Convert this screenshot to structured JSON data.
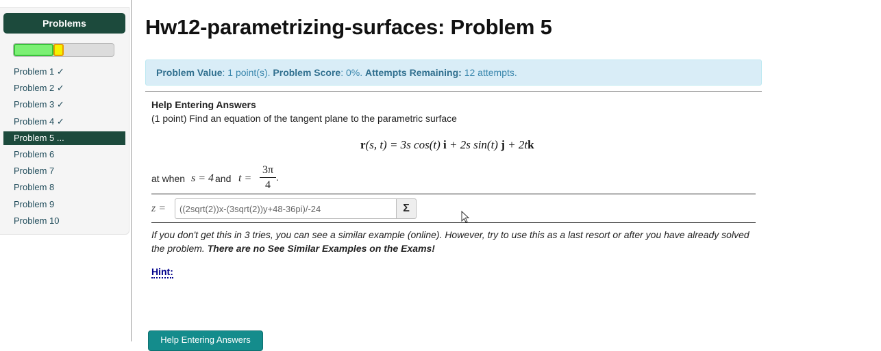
{
  "sidebar": {
    "title": "Problems",
    "progress": {
      "correct_fraction": 0.4,
      "current_fraction": 0.1
    },
    "items": [
      {
        "label": "Problem 1 ✓",
        "active": false
      },
      {
        "label": "Problem 2 ✓",
        "active": false
      },
      {
        "label": "Problem 3 ✓",
        "active": false
      },
      {
        "label": "Problem 4 ✓",
        "active": false
      },
      {
        "label": "Problem 5 ...",
        "active": true
      },
      {
        "label": "Problem 6",
        "active": false
      },
      {
        "label": "Problem 7",
        "active": false
      },
      {
        "label": "Problem 8",
        "active": false
      },
      {
        "label": "Problem 9",
        "active": false
      },
      {
        "label": "Problem 10",
        "active": false
      }
    ]
  },
  "main": {
    "title": "Hw12-parametrizing-surfaces: Problem 5",
    "info": {
      "value_label": "Problem Value",
      "value_text": ": 1 point(s). ",
      "score_label": "Problem Score",
      "score_text": ": 0%. ",
      "attempts_label": "Attempts Remaining:",
      "attempts_text": " 12 attempts."
    },
    "help_heading": "Help Entering Answers",
    "problem_text": "(1 point) Find an equation of the tangent plane to the parametric surface",
    "formula": {
      "lhs": "r",
      "args": "(s, t) = 3",
      "term1": "s cos(t) ",
      "i": "i",
      "term2": " + 2s sin(t) ",
      "j": "j",
      "term3": " + 2t",
      "k": "k"
    },
    "at_when": {
      "prefix": "at when ",
      "s_eq": "s = 4",
      "and": " and ",
      "t_eq": "t =",
      "frac_num": "3π",
      "frac_den": "4",
      "suffix": "."
    },
    "answer": {
      "label": "z =",
      "value": "((2sqrt(2))x-(3sqrt(2))y+48-36pi)/-24",
      "equation_button": "Σ"
    },
    "note_italic": "If you don't get this in 3 tries, you can see a similar example (online). However, try to use this as a last resort or after you have already solved the problem. ",
    "note_bold": "There are no See Similar Examples on the Exams!",
    "hint_label": "Hint:",
    "help_button": "Help Entering Answers"
  }
}
